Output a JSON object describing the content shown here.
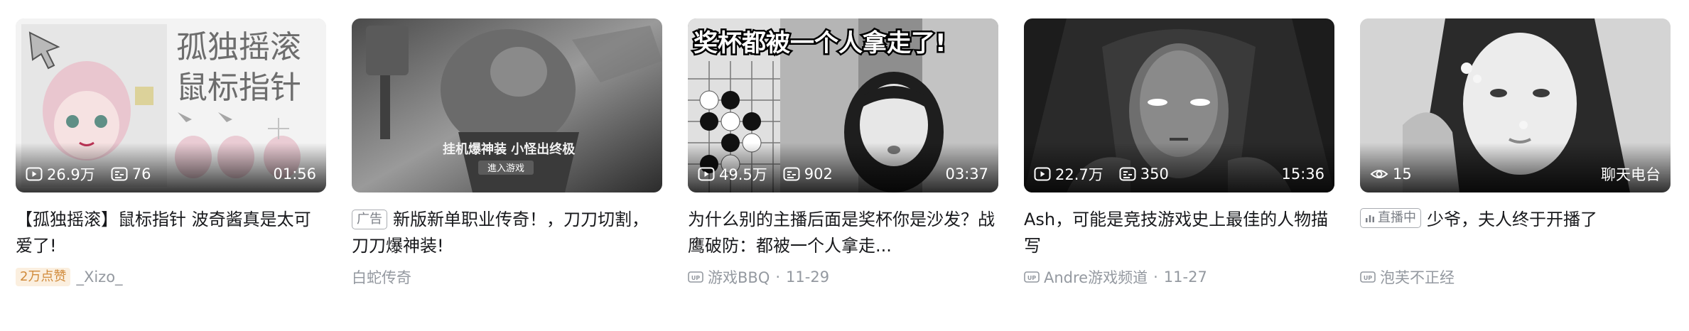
{
  "cards": [
    {
      "thumb_text_lines": [
        "孤独摇滚",
        "鼠标指针"
      ],
      "views": "26.9万",
      "danmaku": "76",
      "duration": "01:56",
      "title": "【孤独摇滚】鼠标指针 波奇酱真是太可爱了!",
      "likes_badge": "2万点赞",
      "author": "_Xizo_"
    },
    {
      "ad_tag": "广告",
      "thumb_text_lines": [
        "挂机爆神装 小怪出终极",
        "進入游戏"
      ],
      "title": "新版新单职业传奇！，刀刀切割，刀刀爆神装!",
      "author": "白蛇传奇"
    },
    {
      "thumb_text_lines": [
        "奖杯都被一个人拿走了!"
      ],
      "views": "49.5万",
      "danmaku": "902",
      "duration": "03:37",
      "title": "为什么别的主播后面是奖杯你是沙发？战鹰破防：都被一个人拿走...",
      "author": "游戏BBQ",
      "date": "11-29"
    },
    {
      "views": "22.7万",
      "danmaku": "350",
      "duration": "15:36",
      "title": "Ash，可能是竞技游戏史上最佳的人物描写",
      "author": "Andre游戏频道",
      "date": "11-27"
    },
    {
      "live_tag": "直播中",
      "viewers": "15",
      "category": "聊天电台",
      "title": "少爷，夫人终于开播了",
      "author": "泡芙不正经"
    }
  ],
  "colors": {
    "title_text": "#18191c",
    "meta_text": "#9499a0",
    "likes_badge_bg": "#fbefdf",
    "likes_badge_text": "#d08a3a"
  },
  "icons": {
    "views": "play-count-icon",
    "danmaku": "danmaku-icon",
    "uploader": "up-icon",
    "viewers": "eye-icon",
    "live": "live-bars-icon"
  }
}
